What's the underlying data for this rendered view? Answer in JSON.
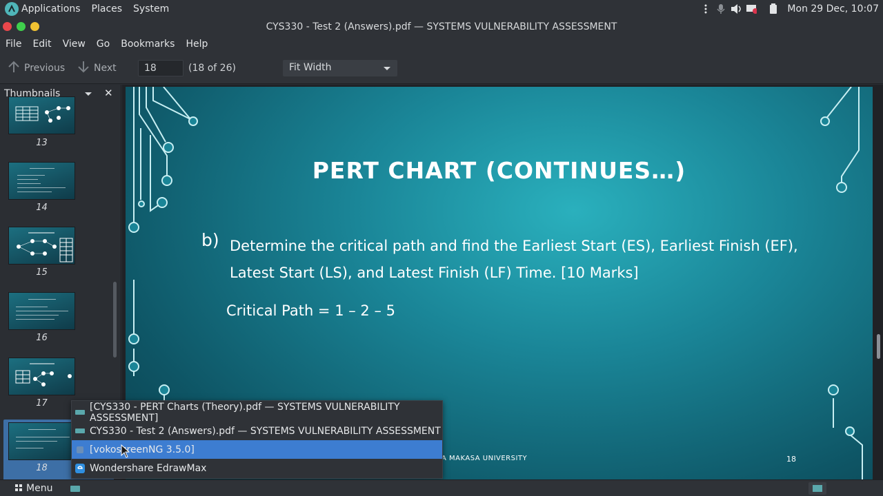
{
  "top_panel": {
    "menus": [
      "Applications",
      "Places",
      "System"
    ],
    "clock": "Mon 29 Dec, 10:07"
  },
  "window": {
    "title": "CYS330 - Test 2 (Answers).pdf — SYSTEMS VULNERABILITY ASSESSMENT"
  },
  "menubar": {
    "items": [
      "File",
      "Edit",
      "View",
      "Go",
      "Bookmarks",
      "Help"
    ]
  },
  "toolbar": {
    "previous_label": "Previous",
    "next_label": "Next",
    "page_value": "18",
    "page_count": "(18 of 26)",
    "zoom_value": "Fit Width"
  },
  "sidebar": {
    "title": "Thumbnails",
    "close_glyph": "✕",
    "pages": [
      "13",
      "14",
      "15",
      "16",
      "17",
      "18"
    ],
    "selected_page": "18"
  },
  "slide": {
    "title": "PERT CHART (CONTINUES…)",
    "marker": "b)",
    "question_line1": "Determine the critical path and find the Earliest Start (ES), Earliest Finish (EF),",
    "question_line2": "Latest Start (LS), and Latest Finish (LF) Time. [10 Marks]",
    "answer": "Critical Path = 1 – 2 – 5",
    "footer_university": "A MAKASA UNIVERSITY",
    "footer_page": "18"
  },
  "popup": {
    "items": [
      "[CYS330 - PERT Charts (Theory).pdf — SYSTEMS VULNERABILITY ASSESSMENT]",
      "CYS330 - Test 2 (Answers).pdf — SYSTEMS VULNERABILITY ASSESSMENT",
      "[vokoscreenNG 3.5.0]",
      "Wondershare EdrawMax"
    ],
    "active_index": 2
  },
  "bottom_panel": {
    "menu_label": "Menu"
  },
  "colors": {
    "accent": "#3d7dd1",
    "slide_teal": "#1a8597",
    "panel_bg": "#2f3237"
  }
}
